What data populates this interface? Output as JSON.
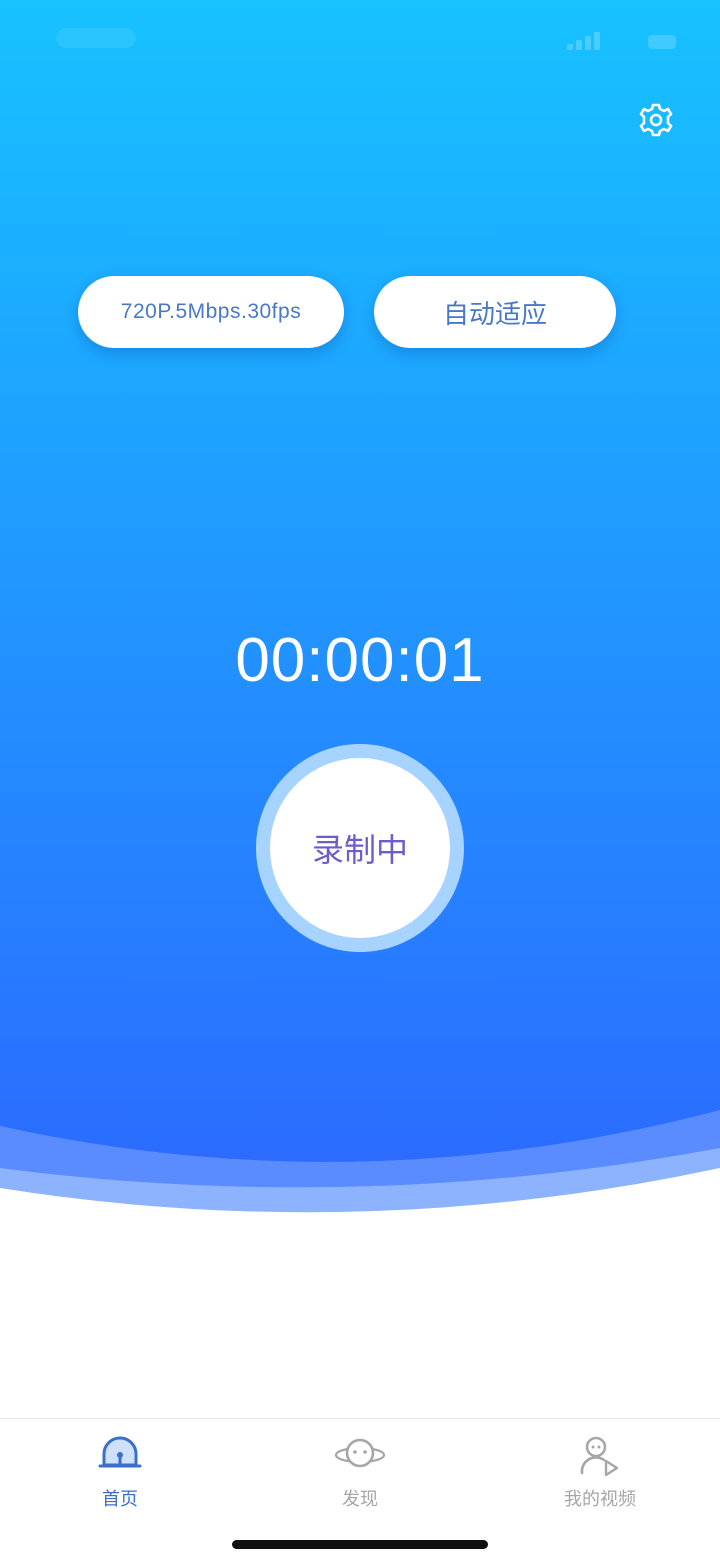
{
  "settings": {
    "icon": "gear-icon"
  },
  "recording_options": {
    "quality_label": "720P.5Mbps.30fps",
    "mode_label": "自动适应"
  },
  "recorder": {
    "elapsed": "00:00:01",
    "state_label": "录制中"
  },
  "tabbar": {
    "active_index": 0,
    "items": [
      {
        "label": "首页",
        "icon": "home-icon"
      },
      {
        "label": "发现",
        "icon": "discover-icon"
      },
      {
        "label": "我的视频",
        "icon": "my-videos-icon"
      }
    ]
  },
  "colors": {
    "gradient_top": "#17c2ff",
    "gradient_bottom": "#2b6cff",
    "wave_light": "#8db3ff",
    "ring": "#a6d3ff",
    "accent_text": "#4a78c9",
    "record_text": "#6d5ccc",
    "tab_active": "#3a6fcc",
    "tab_inactive": "#a6a6a6"
  }
}
